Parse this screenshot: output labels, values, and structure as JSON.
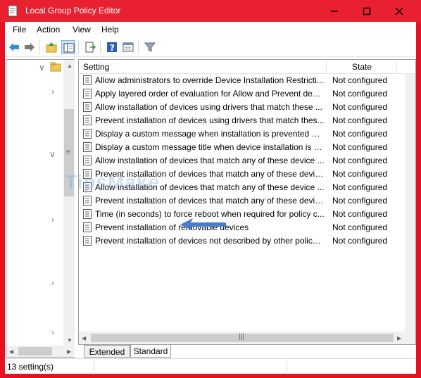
{
  "window": {
    "title": "Local Group Policy Editor"
  },
  "menu": {
    "file": "File",
    "action": "Action",
    "view": "View",
    "help": "Help"
  },
  "list": {
    "headers": {
      "setting": "Setting",
      "state": "State"
    },
    "rows": [
      {
        "setting": "Allow administrators to override Device Installation Restricti...",
        "state": "Not configured"
      },
      {
        "setting": "Apply layered order of evaluation for Allow and Prevent devi...",
        "state": "Not configured"
      },
      {
        "setting": "Allow installation of devices using drivers that match these ...",
        "state": "Not configured"
      },
      {
        "setting": "Prevent installation of devices using drivers that match thes...",
        "state": "Not configured"
      },
      {
        "setting": "Display a custom message when installation is prevented by...",
        "state": "Not configured"
      },
      {
        "setting": "Display a custom message title when device installation is pr...",
        "state": "Not configured"
      },
      {
        "setting": "Allow installation of devices that match any of these device ...",
        "state": "Not configured"
      },
      {
        "setting": "Prevent installation of devices that match any of these devic...",
        "state": "Not configured"
      },
      {
        "setting": "Allow installation of devices that match any of these device ...",
        "state": "Not configured"
      },
      {
        "setting": "Prevent installation of devices that match any of these devic...",
        "state": "Not configured"
      },
      {
        "setting": "Time (in seconds) to force reboot when required for policy c...",
        "state": "Not configured"
      },
      {
        "setting": "Prevent installation of removable devices",
        "state": "Not configured"
      },
      {
        "setting": "Prevent installation of devices not described by other policy ...",
        "state": "Not configured"
      }
    ]
  },
  "tabs": {
    "extended": "Extended",
    "standard": "Standard"
  },
  "status": {
    "text": "13 setting(s)"
  },
  "watermark": {
    "text": "TipsMake"
  },
  "colors": {
    "titlebar": "#e8202f",
    "annotation_arrow": "#4a7cc9"
  }
}
